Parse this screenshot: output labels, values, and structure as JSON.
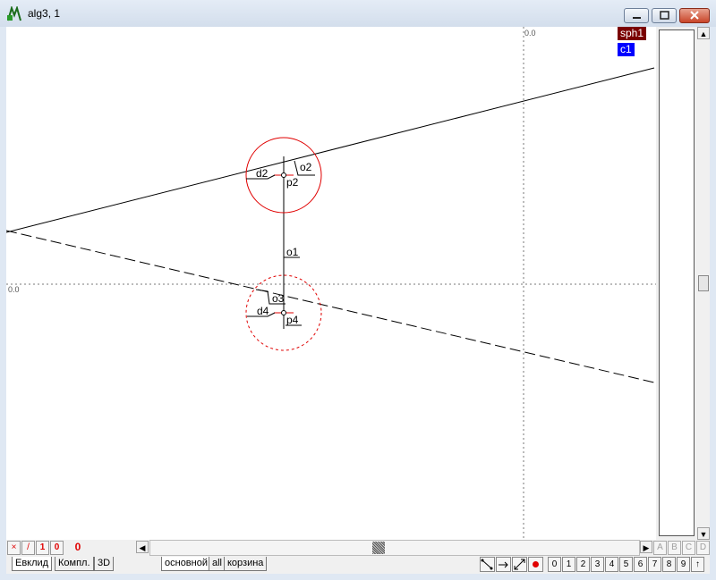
{
  "window": {
    "title": "alg3, 1"
  },
  "legend": [
    {
      "label": "sph1",
      "bg": "#7a0000"
    },
    {
      "label": "c1",
      "bg": "#0000ff"
    }
  ],
  "canvas": {
    "axis_label_top": "0.0",
    "axis_label_left": "0.0",
    "labels": {
      "d2": "d2",
      "o2": "o2",
      "p2": "p2",
      "o1": "o1",
      "o3": "o3",
      "d4": "d4",
      "p4": "p4"
    }
  },
  "status_buttons": [
    "×",
    "/",
    "1",
    "0"
  ],
  "status_count": "0",
  "left_tabs": [
    "Евклид",
    "Компл.",
    "3D"
  ],
  "layer_tabs": [
    "основной",
    "all",
    "корзина"
  ],
  "layer_letters": [
    "A",
    "B",
    "C",
    "D"
  ],
  "number_buttons": [
    "0",
    "1",
    "2",
    "3",
    "4",
    "5",
    "6",
    "7",
    "8",
    "9"
  ],
  "up_arrow": "↑",
  "colors": {
    "circle": "#e00000",
    "line": "#000000",
    "accent": "#e00000"
  }
}
